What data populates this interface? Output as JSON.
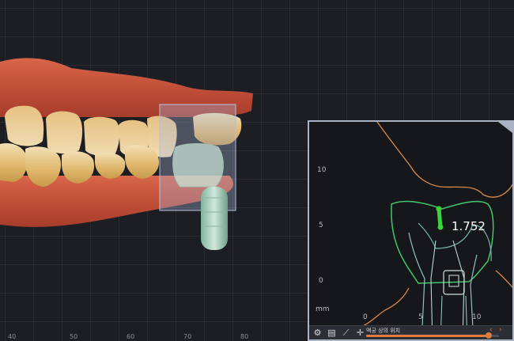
{
  "viewport": {
    "ruler_labels": [
      "40",
      "50",
      "60",
      "70",
      "80"
    ]
  },
  "section_panel": {
    "y_ticks": [
      "10",
      "5",
      "0"
    ],
    "x_ticks": [
      "0",
      "5",
      "10"
    ],
    "unit_label": "mm",
    "measurement": "1.752",
    "toolbar": {
      "slider_label": "액궁 상의 위치",
      "slider_value_fraction": 0.92,
      "prev_symbol": "‹",
      "next_symbol": "›"
    }
  },
  "colors": {
    "accent": "#e07b39",
    "measure": "#3bd43b",
    "panel_border": "#aab3c5"
  }
}
